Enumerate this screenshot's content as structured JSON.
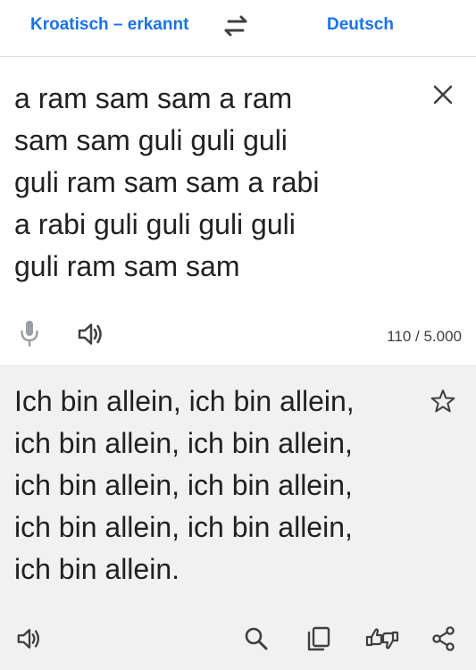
{
  "header": {
    "source_language": "Kroatisch – erkannt",
    "target_language": "Deutsch",
    "swap_icon": "swap-arrows-icon"
  },
  "source": {
    "text": "a ram sam sam a ram\nsam sam guli guli guli\nguli ram sam sam a rabi\na rabi guli guli guli guli\nguli ram sam sam",
    "char_count": "110 / 5.000",
    "icons": [
      "close-icon",
      "microphone-icon",
      "speaker-icon"
    ]
  },
  "translation": {
    "text": "Ich bin allein, ich bin allein,\nich bin allein, ich bin allein,\nich bin allein, ich bin allein,\nich bin allein, ich bin allein,\nich bin allein.",
    "icons": [
      "star-icon",
      "speaker-icon",
      "search-icon",
      "copy-icon",
      "feedback-icon",
      "share-icon"
    ]
  },
  "colors": {
    "accent": "#1a73e8",
    "text": "#202124",
    "icon": "#3c4043",
    "icon_disabled": "#9aa0a6",
    "translation_background": "#f1f1f1"
  }
}
